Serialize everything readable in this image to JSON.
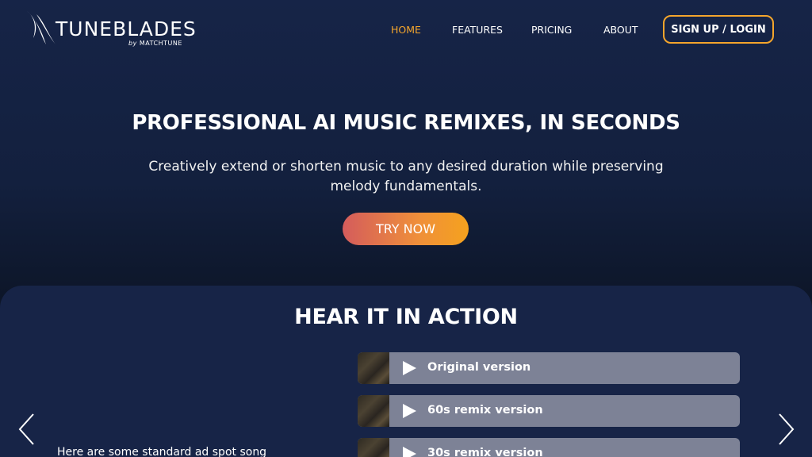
{
  "header": {
    "logo_text": "TUNEBLADES",
    "logo_sub_by": "by",
    "logo_sub_brand": "MATCHTUNE",
    "nav": {
      "home": "HOME",
      "features": "FEATURES",
      "pricing": "PRICING",
      "about": "ABOUT"
    },
    "signup_label": "SIGN UP / LOGIN"
  },
  "hero": {
    "title": "PROFESSIONAL AI MUSIC REMIXES, IN SECONDS",
    "subtitle": "Creatively extend or shorten music to any desired duration while preserving melody fundamentals.",
    "cta_label": "TRY NOW"
  },
  "demo": {
    "title": "HEAR IT IN ACTION",
    "description": "Here are some standard ad spot song",
    "tracks": [
      {
        "label": "Original version"
      },
      {
        "label": "60s remix version"
      },
      {
        "label": "30s remix version"
      }
    ]
  },
  "colors": {
    "accent": "#f4a52c",
    "background": "#162447",
    "track_bg": "#7d8296"
  },
  "icons": {
    "logo": "tuneblades-blade-logo",
    "play": "play-icon",
    "prev": "chevron-left-icon",
    "next": "chevron-right-icon"
  }
}
